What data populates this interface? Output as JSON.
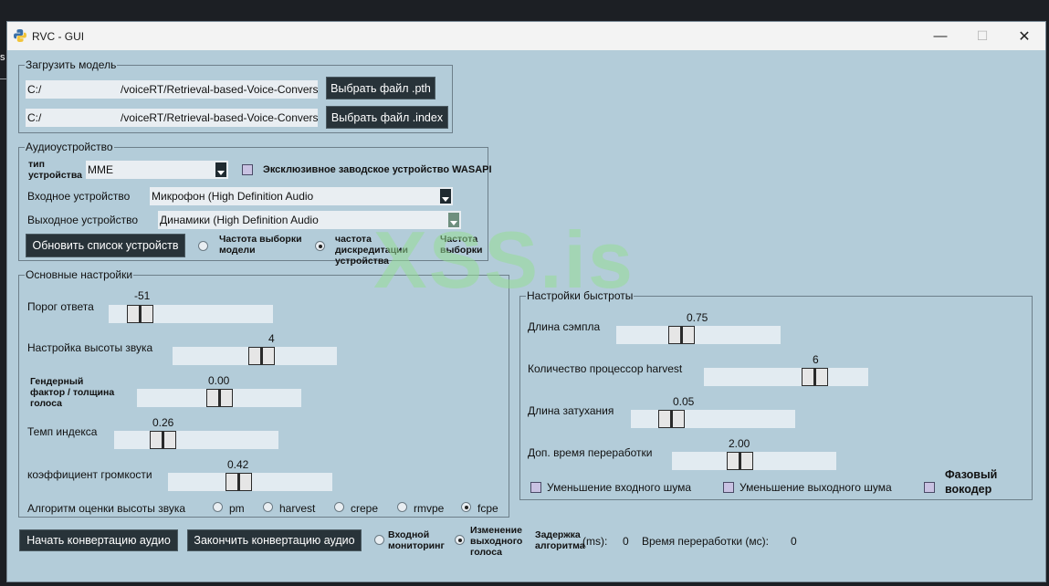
{
  "desktop": {
    "edge_text": "s"
  },
  "window": {
    "title": "RVC - GUI",
    "controls": {
      "minimize": "—",
      "maximize": "☐",
      "close": "✕"
    }
  },
  "load_model": {
    "legend": "Загрузить модель",
    "pth_path": "C:/                          /voiceRT/Retrieval-based-Voice-Convers",
    "pth_button": "Выбрать файл .pth",
    "index_path": "C:/                          /voiceRT/Retrieval-based-Voice-Convers",
    "index_button": "Выбрать файл .index"
  },
  "audio_device": {
    "legend": "Аудиоустройство",
    "type_label": "тип устройства",
    "type_value": "MME",
    "wasapi_label": "Эксклюзивное заводское устройство WASAPI",
    "input_label": "Входное устройство",
    "input_value": "Микрофон (High Definition Audio",
    "output_label": "Выходное устройство",
    "output_value": "Динамики (High Definition Audio",
    "refresh_button": "Обновить список устройств",
    "sr_model_label": "Частота выборки модели",
    "sr_device_label": "частота дискредитации устройства",
    "sr_label": "Частота выборки"
  },
  "main_settings": {
    "legend": "Основные настройки",
    "threshold": {
      "label": "Порог ответа",
      "value": "-51",
      "fraction": 0.13
    },
    "pitch": {
      "label": "Настройка высоты звука",
      "value": "4",
      "fraction": 0.55
    },
    "formant": {
      "label": "Гендерный фактор / толщина голоса",
      "value": "0.00",
      "fraction": 0.5
    },
    "index_rate": {
      "label": "Темп индекса",
      "value": "0.26",
      "fraction": 0.26
    },
    "rms_mix": {
      "label": "коэффициент громкости",
      "value": "0.42",
      "fraction": 0.42
    },
    "f0_label": "Алгоритм оценки высоты звука",
    "f0_methods": [
      {
        "label": "pm",
        "selected": false
      },
      {
        "label": "harvest",
        "selected": false
      },
      {
        "label": "crepe",
        "selected": false
      },
      {
        "label": "rmvpe",
        "selected": false
      },
      {
        "label": "fcpe",
        "selected": true
      }
    ]
  },
  "performance": {
    "legend": "Настройки быстроты",
    "block_time": {
      "label": "Длина сэмпла",
      "value": "0.75",
      "fraction": 0.38
    },
    "n_cpu": {
      "label": "Количество процессор harvest",
      "value": "6",
      "fraction": 0.71
    },
    "crossfade": {
      "label": "Длина затухания",
      "value": "0.05",
      "fraction": 0.2
    },
    "extra_time": {
      "label": "Доп. время переработки",
      "value": "2.00",
      "fraction": 0.4
    },
    "in_noise_label": "Уменьшение входного шума",
    "out_noise_label": "Уменьшение выходного шума",
    "vocoder_label": "Фазовый вокодер"
  },
  "bottom": {
    "start_button": "Начать конвертацию аудио",
    "stop_button": "Закончить конвертацию аудио",
    "input_monitor_label": "Входной мониторинг",
    "output_change_label": "Изменение выходного голоса",
    "delay_label": "Задержка алгоритма",
    "delay_unit": "(ms):",
    "delay_value": "0",
    "infer_label": "Время переработки (мс):",
    "infer_value": "0"
  },
  "watermark": "XSS.is",
  "colors": {
    "window_bg": "#b3ccd9",
    "button_bg": "#283339",
    "checkbox_fill": "#c9c2e2"
  }
}
